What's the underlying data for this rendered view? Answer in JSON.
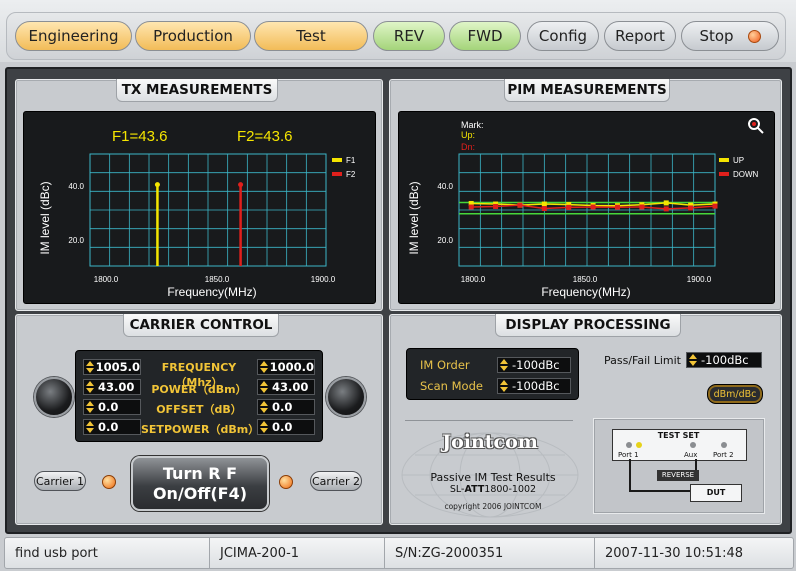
{
  "toolbar": {
    "engineering": "Engineering",
    "production": "Production",
    "test": "Test",
    "rev": "REV",
    "fwd": "FWD",
    "config": "Config",
    "report": "Report",
    "stop": "Stop"
  },
  "tx": {
    "title": "TX MEASUREMENTS",
    "f1_readout": "F1=43.6",
    "f2_readout": "F2=43.6",
    "ylabel": "IM level (dBc)",
    "xlabel": "Frequency(MHz)",
    "y_ticks": [
      "40.0",
      "20.0"
    ],
    "x_ticks": [
      "1800.0",
      "1850.0",
      "1900.0"
    ],
    "legend": [
      "F1",
      "F2"
    ]
  },
  "pim": {
    "title": "PIM MEASUREMENTS",
    "mark_label": "Mark:",
    "up_label": "Up:",
    "dn_label": "Dn:",
    "ylabel": "IM level (dBc)",
    "xlabel": "Frequency(MHz)",
    "y_ticks": [
      "40.0",
      "20.0"
    ],
    "x_ticks": [
      "1800.0",
      "1850.0",
      "1900.0"
    ],
    "legend": [
      "UP",
      "DOWN"
    ]
  },
  "carrier": {
    "title": "CARRIER CONTROL",
    "rows": [
      {
        "left": "1005.0",
        "label": "FREQUENCY（Mhz）",
        "right": "1000.0"
      },
      {
        "left": "43.00",
        "label": "POWER（dBm）",
        "right": "43.00"
      },
      {
        "left": "0.0",
        "label": "OFFSET（dB）",
        "right": "0.0"
      },
      {
        "left": "0.0",
        "label": "SETPOWER（dBm）",
        "right": "0.0"
      }
    ],
    "carrier1": "Carrier 1",
    "carrier2": "Carrier 2",
    "rf_line1": "Turn R F",
    "rf_line2": "On/Off(F4)"
  },
  "display": {
    "title": "DISPLAY PROCESSING",
    "im_order_label": "IM Order",
    "im_order_value": "-100dBc",
    "scan_mode_label": "Scan Mode",
    "scan_mode_value": "-100dBc",
    "pass_fail_label": "Pass/Fail Limit",
    "pass_fail_value": "-100dBc",
    "unit_button": "dBm/dBc",
    "logo": "Jointcom",
    "caption1": "Passive IM Test Results",
    "caption2_prefix": "SL-",
    "caption2_bold": "ATT",
    "caption2_suffix": "1800-1002",
    "copyright": "copyright 2006 JOINTCOM",
    "testset_title": "TEST SET",
    "port1": "Port 1",
    "aux": "Aux",
    "port2": "Port 2",
    "reverse": "REVERSE",
    "dut": "DUT"
  },
  "status": {
    "message": "find usb port",
    "model": "JCIMA-200-1",
    "serial": "S/N:ZG-2000351",
    "datetime": "2007-11-30 10:51:48"
  },
  "colors": {
    "f1": "#f5e500",
    "f2": "#e0201c",
    "up": "#f5e500",
    "down": "#e0201c",
    "limit": "#46d63a",
    "grid": "#3bb6c8",
    "label_yellow": "#f1c437"
  },
  "chart_data": [
    {
      "type": "bar",
      "title": "",
      "xlabel": "Frequency(MHz)",
      "ylabel": "IM level (dBc)",
      "xlim": [
        1795,
        1900
      ],
      "ylim": [
        0,
        60
      ],
      "series": [
        {
          "name": "F1",
          "x": [
            1825
          ],
          "values": [
            43.6
          ]
        },
        {
          "name": "F2",
          "x": [
            1862
          ],
          "values": [
            43.6
          ]
        }
      ]
    },
    {
      "type": "line",
      "title": "",
      "xlabel": "Frequency(MHz)",
      "ylabel": "IM level (dBc)",
      "xlim": [
        1795,
        1900
      ],
      "ylim": [
        0,
        60
      ],
      "limit_lines": [
        34,
        28
      ],
      "series": [
        {
          "name": "UP",
          "x": [
            1800,
            1810,
            1820,
            1830,
            1840,
            1850,
            1860,
            1870,
            1880,
            1890,
            1900
          ],
          "values": [
            33.5,
            33.2,
            32.6,
            33.2,
            32.9,
            32.4,
            32.3,
            32.8,
            33.8,
            32.6,
            33.2
          ]
        },
        {
          "name": "DOWN",
          "x": [
            1800,
            1810,
            1820,
            1830,
            1840,
            1850,
            1860,
            1870,
            1880,
            1890,
            1900
          ],
          "values": [
            31.6,
            31.9,
            32.6,
            30.8,
            31.4,
            31.6,
            31.5,
            31.6,
            30.6,
            31.1,
            32.1
          ]
        }
      ]
    }
  ]
}
